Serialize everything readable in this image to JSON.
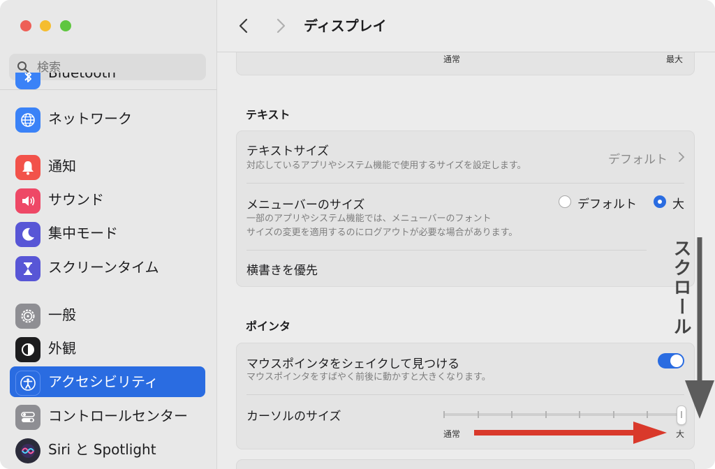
{
  "search": {
    "placeholder": "検索"
  },
  "sidebar": {
    "cut_item": {
      "label": "Bluetooth",
      "icon": "bluetooth-icon"
    },
    "items": [
      {
        "label": "ネットワーク",
        "icon": "globe-icon",
        "color": "#3a82f7"
      },
      {
        "label": "通知",
        "icon": "bell-icon",
        "color": "#f2524a"
      },
      {
        "label": "サウンド",
        "icon": "speaker-icon",
        "color": "#ee4866"
      },
      {
        "label": "集中モード",
        "icon": "moon-icon",
        "color": "#5856d6"
      },
      {
        "label": "スクリーンタイム",
        "icon": "hourglass-icon",
        "color": "#5856d6"
      },
      {
        "label": "一般",
        "icon": "gear-icon",
        "color": "#8e8e93"
      },
      {
        "label": "外観",
        "icon": "appearance-icon",
        "color": "#1c1c1e"
      },
      {
        "label": "アクセシビリティ",
        "icon": "accessibility-icon",
        "color": "#2a6ce1",
        "active": true
      },
      {
        "label": "コントロールセンター",
        "icon": "control-center-icon",
        "color": "#8e8e93"
      },
      {
        "label": "Siri と Spotlight",
        "icon": "siri-icon",
        "color": "#2b2b3a"
      }
    ]
  },
  "header": {
    "title": "ディスプレイ"
  },
  "top_card": {
    "left_label": "通常",
    "right_label": "最大"
  },
  "text_section": {
    "title": "テキスト",
    "text_size": {
      "title": "テキストサイズ",
      "subtitle": "対応しているアプリやシステム機能で使用するサイズを設定します。",
      "value": "デフォルト"
    },
    "menubar": {
      "title": "メニューバーのサイズ",
      "subtitle_1": "一部のアプリやシステム機能では、メニューバーのフォント",
      "subtitle_2": "サイズの変更を適用するのにログアウトが必要な場合があります。",
      "option_default": "デフォルト",
      "option_large": "大",
      "selected": "大"
    },
    "horizontal": {
      "title": "横書きを優先"
    }
  },
  "pointer_section": {
    "title": "ポインタ",
    "shake": {
      "title": "マウスポインタをシェイクして見つける",
      "subtitle": "マウスポインタをすばやく前後に動かすと大きくなります。",
      "enabled": true
    },
    "cursor_size": {
      "title": "カーソルのサイズ",
      "min_label": "通常",
      "max_label": "大",
      "value": 1.0
    }
  },
  "annotations": {
    "scroll_text": "スクロール",
    "accent_red": "#d9392b",
    "arrow_gray": "#5c5c5c"
  },
  "colors": {
    "accent": "#2a6ce1"
  }
}
